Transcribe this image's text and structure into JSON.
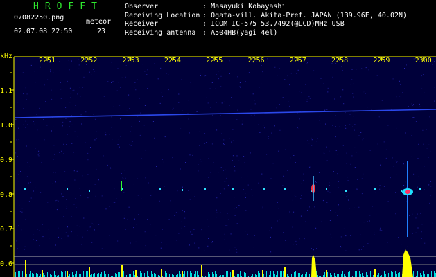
{
  "header": {
    "app_title": "HROFFT",
    "filename": "07082250.png",
    "timestamp": "02.07.08 22:50",
    "meteor_label": "meteor",
    "meteor_count": "23",
    "info": [
      {
        "label": "Observer",
        "sep": ":",
        "value": "Masayuki Kobayashi"
      },
      {
        "label": "Receiving Location",
        "sep": ":",
        "value": "Ogata-vill. Akita-Pref. JAPAN (139.96E, 40.02N)"
      },
      {
        "label": "Receiver",
        "sep": ":",
        "value": "ICOM IC-575 53.7492(@LCD)MHz USB"
      },
      {
        "label": "Receiving antenna",
        "sep": ":",
        "value": "A504HB(yagi 4el)"
      }
    ]
  },
  "spectrogram": {
    "unit_label": "kHz",
    "time_labels": [
      "2251",
      "2252",
      "2253",
      "2254",
      "2255",
      "2256",
      "2257",
      "2258",
      "2259",
      "2300"
    ],
    "freq_labels": [
      "1.1",
      "1.0",
      "0.9",
      "0.8",
      "0.7",
      "0.6"
    ],
    "colors": {
      "background": "#00003a",
      "label": "#ffff00",
      "axis": "#ffff00",
      "trace": "#3050ff",
      "power": "#ffff00",
      "noise": "#00e0e0"
    }
  }
}
